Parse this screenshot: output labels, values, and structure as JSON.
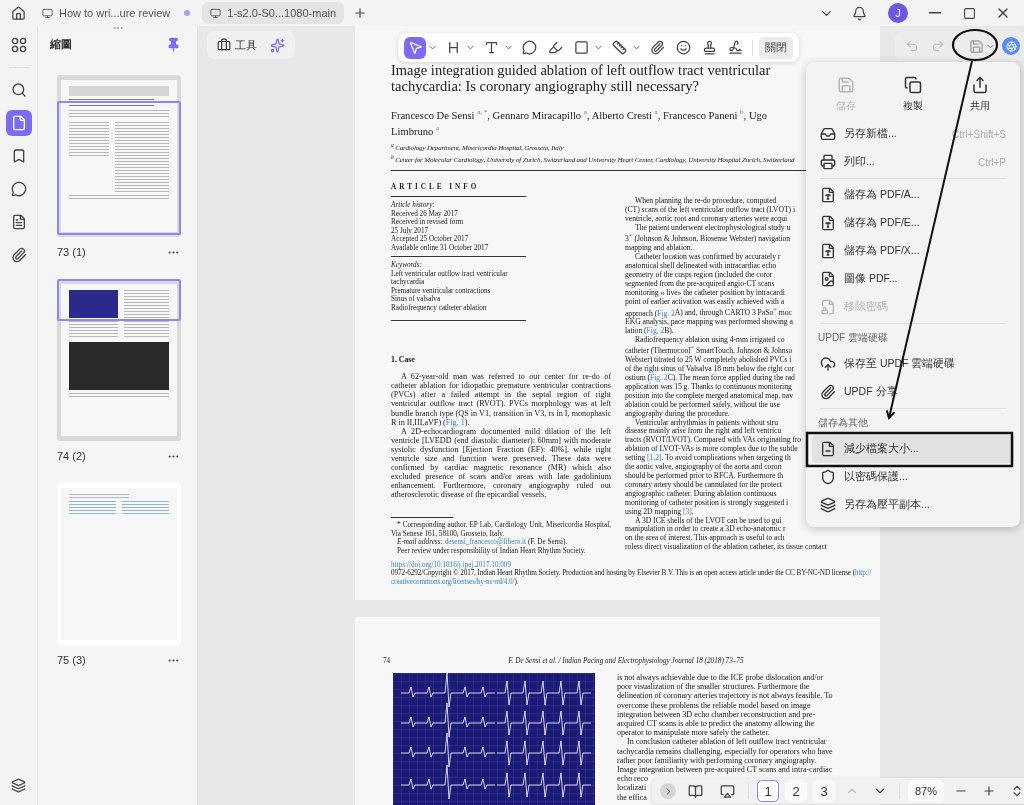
{
  "title_bar": {
    "tabs": [
      {
        "label": "How to wri...ure review",
        "selected": false,
        "unsaved": true
      },
      {
        "label": "1-s2.0-S0...1080-main",
        "selected": true,
        "unsaved": false
      }
    ],
    "avatar": "J"
  },
  "sidebar": {
    "items": [
      {
        "kind": "grid",
        "selected": false
      },
      {
        "kind": "search",
        "selected": false
      },
      {
        "kind": "pages",
        "selected": true
      },
      {
        "kind": "bookmark",
        "selected": false
      },
      {
        "kind": "comment",
        "selected": false
      },
      {
        "kind": "form",
        "selected": false
      },
      {
        "kind": "attachment",
        "selected": false
      }
    ]
  },
  "thumbnails": {
    "title": "縮圖",
    "pages": [
      {
        "label": "73 (1)",
        "kind": "article",
        "in_view": true,
        "view_at_top": false
      },
      {
        "label": "74 (2)",
        "kind": "figures",
        "in_view": true,
        "view_at_top": true
      },
      {
        "label": "75 (3)",
        "kind": "references",
        "in_view": false
      }
    ]
  },
  "toolbar": {
    "tools_button": "工具",
    "tools": [
      {
        "kind": "select",
        "selected": true,
        "menu": true
      },
      {
        "kind": "heading",
        "selected": false,
        "menu": true
      },
      {
        "kind": "text",
        "selected": false,
        "menu": true
      },
      {
        "kind": "comment",
        "selected": false,
        "menu": false
      },
      {
        "kind": "highlight",
        "selected": false,
        "menu": false
      },
      {
        "kind": "shape",
        "selected": false,
        "menu": true
      },
      {
        "kind": "measure",
        "selected": false,
        "menu": true
      },
      {
        "kind": "attach",
        "selected": false,
        "menu": false
      },
      {
        "kind": "sticker",
        "selected": false,
        "menu": false
      },
      {
        "kind": "stamp",
        "selected": false,
        "menu": false
      },
      {
        "kind": "signature",
        "selected": false,
        "menu": false
      }
    ],
    "close": "關閉",
    "history": [
      {
        "kind": "undo",
        "disabled": true
      },
      {
        "kind": "redo",
        "disabled": true
      }
    ]
  },
  "save_menu": {
    "open": true,
    "actions": [
      {
        "kind": "save",
        "label": "儲存",
        "disabled": true
      },
      {
        "kind": "copy",
        "label": "複製",
        "disabled": false
      },
      {
        "kind": "share",
        "label": "共用",
        "disabled": false
      }
    ],
    "entries": [
      {
        "kind": "save-as",
        "label": "另存新檔...",
        "shortcut": "Ctrl+Shift+S",
        "disabled": false,
        "selected": false
      },
      {
        "kind": "print",
        "label": "列印...",
        "shortcut": "Ctrl+P",
        "disabled": false,
        "selected": false
      },
      {
        "kind": "divider"
      },
      {
        "kind": "pdf-a",
        "label": "儲存為 PDF/A...",
        "disabled": false,
        "selected": false
      },
      {
        "kind": "pdf-e",
        "label": "儲存為 PDF/E...",
        "disabled": false,
        "selected": false
      },
      {
        "kind": "pdf-x",
        "label": "儲存為 PDF/X...",
        "disabled": false,
        "selected": false
      },
      {
        "kind": "image-pdf",
        "label": "圖像 PDF...",
        "disabled": false,
        "selected": false
      },
      {
        "kind": "remove-password",
        "label": "移除密碼",
        "disabled": true,
        "selected": false
      },
      {
        "kind": "divider"
      },
      {
        "kind": "header",
        "label": "UPDF 雲端硬碟"
      },
      {
        "kind": "cloud",
        "label": "保存至 UPDF 雲端硬碟",
        "disabled": false,
        "selected": false
      },
      {
        "kind": "share-link",
        "label": "UPDF 分享",
        "disabled": false,
        "selected": false
      },
      {
        "kind": "divider"
      },
      {
        "kind": "header",
        "label": "儲存為其他"
      },
      {
        "kind": "compress",
        "label": "減少檔案大小...",
        "disabled": false,
        "selected": true
      },
      {
        "kind": "protect",
        "label": "以密碼保護...",
        "disabled": false,
        "selected": false
      },
      {
        "kind": "flatten",
        "label": "另存為壓平副本...",
        "disabled": false,
        "selected": false
      }
    ]
  },
  "page_1": {
    "title": "Image integration guided ablation of left outflow tract ventricular tachycardia: Is coronary angiography still necessary?",
    "authors": "Francesco De Sensi $^{a, *}$, Gennaro Miracapillo $^{a}$, Alberto Cresti $^{a}$, Francesco Paneni $^{b}$, Ugo Limbruno $^{a}$",
    "affiliations": [
      "$^{a}$ Cardiology Department, Misericordia Hospital, Grosseto, Italy",
      "$^{b}$ Center for Molecular Cardiology, University of Zurich, Switzerland and University Heart Center, Cardiology, University Hospital Zurich, Switzerland"
    ],
    "article_info_heading": "ARTICLE INFO",
    "history": {
      "heading": "Article history:",
      "lines": [
        "Received 26 May 2017",
        "Received in revised form",
        "25 July 2017",
        "Accepted 25 October 2017",
        "Available online 31 October 2017"
      ]
    },
    "keywords": {
      "heading": "Keywords:",
      "lines": [
        "Left ventricular outflow tract ventricular",
        "tachycardia",
        "Premature ventricular contractions",
        "Sinus of valsalva",
        "Radiofrequency catheter ablation"
      ]
    },
    "section_heading": "1. Case",
    "paragraphs": [
      [
        {
          "kind": "text",
          "text": "A 62-year-old man was referred to our center for re-do of catheter ablation for idiopathic premature ventricular contractions (PVCs) after a failed attempt in the septal region of right ventricular outflow tract (RVOT). PVCs morphology was at left bundle branch type (QS in V1, transition in V3, rs in I, monophasic R in II,III,aVF) ("
        },
        {
          "kind": "link",
          "text": "Fig. 1"
        },
        {
          "kind": "text",
          "text": ")."
        }
      ],
      [
        {
          "kind": "text",
          "text": "A 2D-echocardiogram documented mild dilation of the left ventricle [LVEDD (end diastolic diameter): 60mm] with moderate systolic dysfunction [Ejection Fraction (EF): 40%], while right ventricle size and function were preserved. These data were confirmed by cardiac magnetic resonance (MR) which also excluded presence of scars and/or areas with late gadolinium enhancement. Furthermore, coronary angiography ruled out atherosclerotic disease of the epicardial vessels."
        }
      ]
    ],
    "footnotes": [
      [
        {
          "kind": "text",
          "text": "* Corresponding author. EP Lab, Cardiology Unit, Misericordia Hospital, Via Senese 161, 58100, Grosseto, Italy."
        }
      ],
      [
        {
          "kind": "text",
          "text": "*E-mail address:* "
        },
        {
          "kind": "link",
          "text": "desensi_francesco@libero.it"
        },
        {
          "kind": "text",
          "text": " (F. De Sensi)."
        }
      ],
      [
        {
          "kind": "text",
          "text": "Peer review under responsibility of Indian Heart Rhythm Society."
        }
      ]
    ],
    "doi": "https://doi.org/10.1016/j.ipej.2017.10.009",
    "copyright_lines": [
      [
        {
          "kind": "text",
          "text": "0972-6292/Copyright © 2017, Indian Heart Rhythm Society. Production and hosting by Elsevier B.V. This is an open access article under the CC BY-NC-ND license ("
        },
        {
          "kind": "link",
          "text": "http://"
        }
      ],
      [
        {
          "kind": "link",
          "text": "creativecommons.org/licenses/by-nc-nd/4.0/"
        },
        {
          "kind": "text",
          "text": ")."
        }
      ]
    ],
    "right_column": [
      {
        "indent": true,
        "text": "When planning the re-do procedure, computed"
      },
      {
        "indent": false,
        "text": "(CT) scans of the left ventricular outflow tract (LVOT) i"
      },
      {
        "indent": false,
        "text": "ventricle, aortic root and coronary arteries were acqui"
      },
      {
        "indent": true,
        "text": "The patient underwent electrophysiological study u"
      },
      {
        "indent": false,
        "text": "3$^{®}$ (Johnson & Johnson, Biosense Webster) navigation"
      },
      {
        "indent": false,
        "text": "mapping and ablation."
      },
      {
        "indent": true,
        "text": "Catheter location was confirmed by accurately r"
      },
      {
        "indent": false,
        "text": "anatomical shell delineated with intracardiac echo"
      },
      {
        "indent": false,
        "text": "geometry of the cusps region (included the coror"
      },
      {
        "indent": false,
        "text": "segmented from the pre-acquired angio-CT scans"
      },
      {
        "indent": false,
        "text": "monitoring « live» the catheter position by intracardi"
      },
      {
        "indent": false,
        "text": "point of earlier activation was easily achieved with a"
      },
      {
        "indent": false,
        "parts": [
          {
            "kind": "text",
            "text": "approach ("
          },
          {
            "kind": "link",
            "text": "Fig. 2"
          },
          {
            "kind": "text",
            "text": "A) and, through CARTO 3 PaSo$^{®}$ moc"
          }
        ]
      },
      {
        "indent": false,
        "text": "EKG analysis, pace mapping was performed showing a"
      },
      {
        "indent": false,
        "parts": [
          {
            "kind": "text",
            "text": "lation ("
          },
          {
            "kind": "link",
            "text": "Fig. 2"
          },
          {
            "kind": "text",
            "text": "B)."
          }
        ]
      },
      {
        "indent": true,
        "text": "Radiofrequency ablation using 4-mm irrigated co"
      },
      {
        "indent": false,
        "text": "catheter (Thermocool$^{®}$ SmartTouch, Johnson & Johnso"
      },
      {
        "indent": false,
        "text": "Webster) titrated to 25 W completely abolished PVCs i"
      },
      {
        "indent": false,
        "text": "of the right sinus of Valsalva 18 mm below the right cor"
      },
      {
        "indent": false,
        "parts": [
          {
            "kind": "text",
            "text": "ostium ("
          },
          {
            "kind": "link",
            "text": "Fig. 2"
          },
          {
            "kind": "text",
            "text": "C). The mean force applied during the rad"
          }
        ]
      },
      {
        "indent": false,
        "text": "application was 15 g. Thanks to continuous monitoring"
      },
      {
        "indent": false,
        "text": "position into the complete merged anatomical map, nav"
      },
      {
        "indent": false,
        "text": "ablation could be performed safely, without the use"
      },
      {
        "indent": false,
        "text": "angiography during the procedure."
      },
      {
        "indent": true,
        "text": "Ventricular arrhythmias in patients without stru"
      },
      {
        "indent": false,
        "text": "disease mainly arise from the right and left ventricu"
      },
      {
        "indent": false,
        "text": "tracts (RVOT/LVOT). Compared with VAs originating fro"
      },
      {
        "indent": false,
        "text": "ablation of LVOT-VAs is more complex due to the subtle"
      },
      {
        "indent": false,
        "parts": [
          {
            "kind": "text",
            "text": "setting "
          },
          {
            "kind": "link",
            "text": "[1,2]"
          },
          {
            "kind": "text",
            "text": ". To avoid complications when targeting th"
          }
        ]
      },
      {
        "indent": false,
        "text": "the aortic valve, angiography of the aorta and coron"
      },
      {
        "indent": false,
        "text": "should be performed prior to RFCA. Furthermore th"
      },
      {
        "indent": false,
        "text": "coronary artery should be cannulated for the protect"
      },
      {
        "indent": false,
        "text": "angiographic catheter. During ablation continuous"
      },
      {
        "indent": false,
        "text": "monitoring of catheter position is strongly suggested i"
      },
      {
        "indent": false,
        "parts": [
          {
            "kind": "text",
            "text": "using 2D mapping "
          },
          {
            "kind": "link",
            "text": "[3]"
          },
          {
            "kind": "text",
            "text": "."
          }
        ]
      },
      {
        "indent": true,
        "text": "A 3D ICE shells of the LVOT can be used to gui"
      },
      {
        "indent": false,
        "text": "manipulation in order to create a 3D echo-anatomic r"
      },
      {
        "indent": false,
        "text": "on the area of interest. This approach is useful to ach"
      },
      {
        "indent": false,
        "text": "roless direct visualization of the ablation catheter, its tissue contact"
      }
    ]
  },
  "page_2": {
    "page_number": "74",
    "running_head": "F. De Sensi et al. / Indian Pacing and Electrophysiology Journal 18 (2018) 73–75",
    "lines": [
      {
        "indent": false,
        "text": "is not always achievable due to the ICE probe dislocation and/or"
      },
      {
        "indent": false,
        "text": "poor visualization of the smaller structures. Furthermore the"
      },
      {
        "indent": false,
        "text": "delineation of coronary arteries trajectory is not always feasible. To"
      },
      {
        "indent": false,
        "text": "overcome these problems the reliable model based on image"
      },
      {
        "indent": false,
        "text": "integration between 3D echo chamber reconstruction and pre-"
      },
      {
        "indent": false,
        "text": "acquired CT scans is able to predict the anatomy allowing the"
      },
      {
        "indent": false,
        "text": "operator to manipulate more safely the catheter."
      },
      {
        "indent": true,
        "text": "In conclusion catheter ablation of left outflow tract ventricular"
      },
      {
        "indent": false,
        "text": "tachycardia remains challenging, especially for operators who have"
      },
      {
        "indent": false,
        "text": "rather poor familiarity with performing coronary angiography."
      },
      {
        "indent": false,
        "text": "Image integration between pre-acquired CT scans and intra-cardiac"
      },
      {
        "indent": false,
        "text": "echo reco"
      },
      {
        "indent": false,
        "text": "localizati"
      },
      {
        "indent": false,
        "text": "the effica"
      }
    ]
  },
  "bottom_bar": {
    "pages": [
      {
        "label": "1",
        "selected": true
      },
      {
        "label": "2",
        "selected": false
      },
      {
        "label": "3",
        "selected": false
      }
    ],
    "nav": [
      {
        "kind": "up",
        "disabled": true
      },
      {
        "kind": "down",
        "disabled": false
      }
    ],
    "zoom": "87%"
  }
}
